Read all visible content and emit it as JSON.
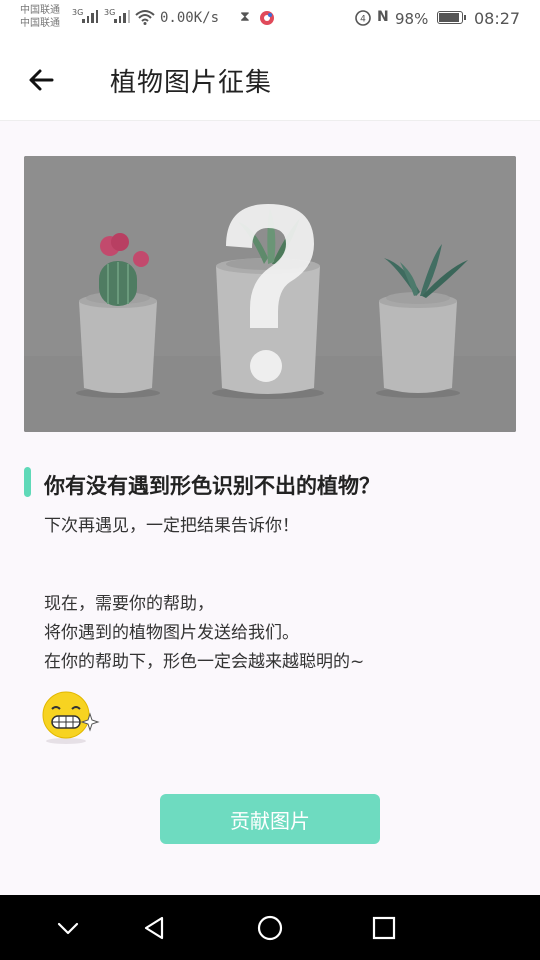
{
  "status_bar": {
    "carrier_1": "中国联通",
    "carrier_2": "中国联通",
    "network_1": "3G",
    "network_2": "3G",
    "net_speed": "0.00K/s",
    "battery_percent": "98%",
    "battery_level": 0.98,
    "time": "08:27"
  },
  "header": {
    "title": "植物图片征集"
  },
  "content": {
    "headline": "你有没有遇到形色识别不出的植物？",
    "subline": "下次再遇见，一定把结果告诉你！",
    "paragraph": [
      "现在，需要你的帮助，",
      "将你遇到的植物图片发送给我们。",
      "在你的帮助下，形色一定会越来越聪明的~"
    ]
  },
  "actions": {
    "contribute_label": "贡献图片"
  },
  "colors": {
    "accent": "#5fd9b8",
    "button": "#6edbc0"
  }
}
